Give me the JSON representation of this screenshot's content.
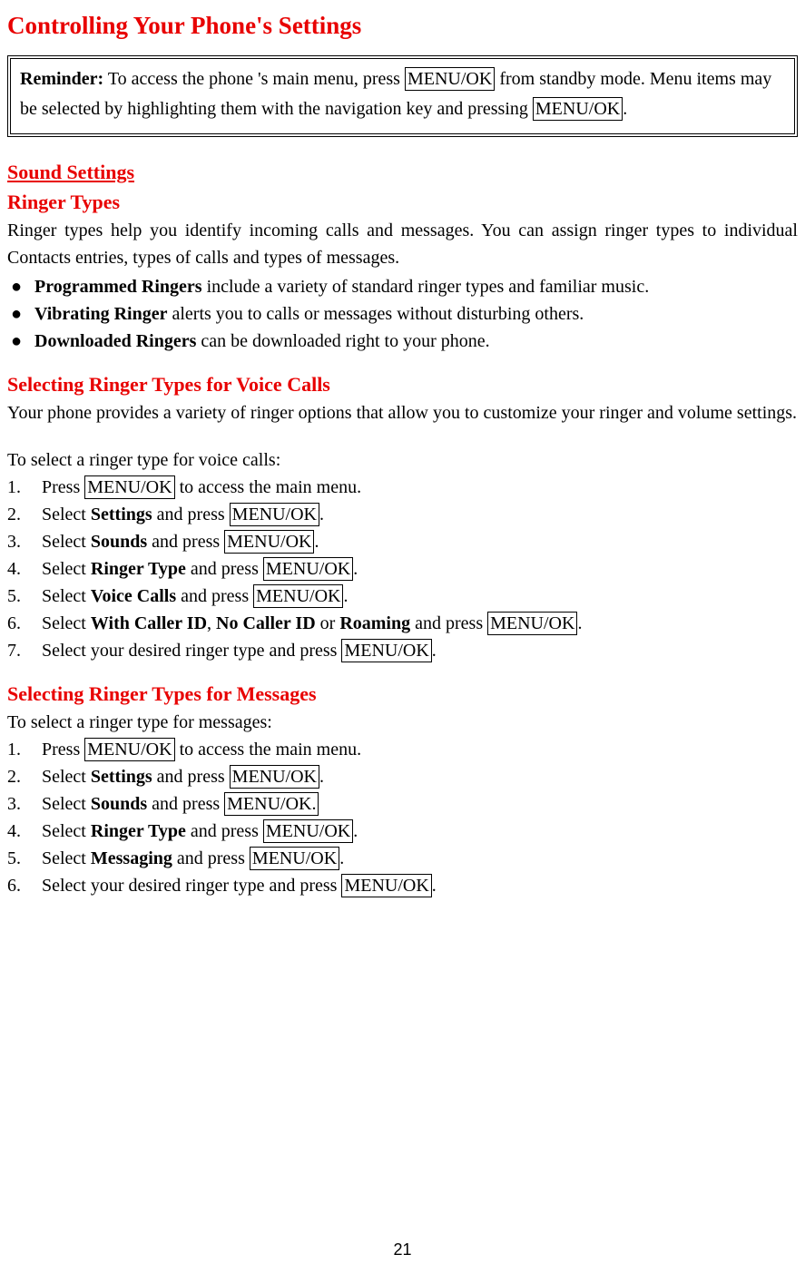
{
  "title": "Controlling Your Phone's Settings",
  "reminder": {
    "label": "Reminder:",
    "t1": " To access the phone 's main menu, press ",
    "k1": "MENU/OK",
    "t2": " from standby mode. Menu items may be selected by highlighting them with the navigation key and pressing ",
    "k2": "MENU/OK",
    "t3": "."
  },
  "sound": {
    "h1": "Sound Settings",
    "h2": "Ringer Types",
    "intro": "Ringer types help you identify incoming calls and messages. You can assign ringer types to individual Contacts entries, types of calls and types of messages.",
    "bullets": [
      {
        "b": "Programmed Ringers",
        "rest": " include a variety of standard ringer types and familiar music."
      },
      {
        "b": "Vibrating Ringer",
        "rest": " alerts you to calls or messages without disturbing others."
      },
      {
        "b": "Downloaded Ringers",
        "rest": " can be downloaded right to your phone."
      }
    ]
  },
  "voice": {
    "h": "Selecting Ringer Types for Voice Calls",
    "intro": "Your phone provides a variety of ringer options that allow you to customize your ringer and volume settings.",
    "lead": "To select a ringer type for voice calls:",
    "steps": [
      {
        "n": "1.",
        "pre": "Press ",
        "k": "MENU/OK",
        "post": " to access the main menu."
      },
      {
        "n": "2.",
        "pre": "Select ",
        "b": "Settings",
        "mid": " and press ",
        "k": "MENU/OK",
        "post": "."
      },
      {
        "n": "3.",
        "pre": "Select ",
        "b": "Sounds",
        "mid": " and press ",
        "k": "MENU/OK",
        "post": "."
      },
      {
        "n": "4.",
        "pre": "Select ",
        "b": "Ringer Type",
        "mid": " and press ",
        "k": "MENU/OK",
        "post": "."
      },
      {
        "n": "5.",
        "pre": "Select ",
        "b": "Voice Calls",
        "mid": " and press ",
        "k": "MENU/OK",
        "post": "."
      },
      {
        "n": "6.",
        "pre": "Select ",
        "b": "With Caller ID",
        "sep1": ", ",
        "b2": "No Caller ID",
        "sep2": " or ",
        "b3": "Roaming",
        "mid": " and press ",
        "k": "MENU/OK",
        "post": "."
      },
      {
        "n": "7.",
        "pre": "Select your desired ringer type and press ",
        "k": "MENU/OK",
        "post": "."
      }
    ]
  },
  "messages": {
    "h": "Selecting Ringer Types for Messages",
    "lead": "To select a ringer type for messages:",
    "steps": [
      {
        "n": "1.",
        "pre": "Press ",
        "k": "MENU/OK",
        "post": " to access the main menu."
      },
      {
        "n": "2.",
        "pre": "Select ",
        "b": "Settings",
        "mid": " and press ",
        "k": "MENU/OK",
        "post": "."
      },
      {
        "n": "3.",
        "pre": "Select ",
        "b": "Sounds",
        "mid": " and press ",
        "k": "MENU/OK.",
        "post": ""
      },
      {
        "n": "4.",
        "pre": "Select ",
        "b": "Ringer Type",
        "mid": " and press ",
        "k": "MENU/OK",
        "post": "."
      },
      {
        "n": "5.",
        "pre": "Select ",
        "b": "Messaging",
        "mid": " and press ",
        "k": "MENU/OK",
        "post": "."
      },
      {
        "n": "6.",
        "pre": "Select your desired ringer type and press ",
        "k": "MENU/OK",
        "post": "."
      }
    ]
  },
  "pageNum": "21"
}
